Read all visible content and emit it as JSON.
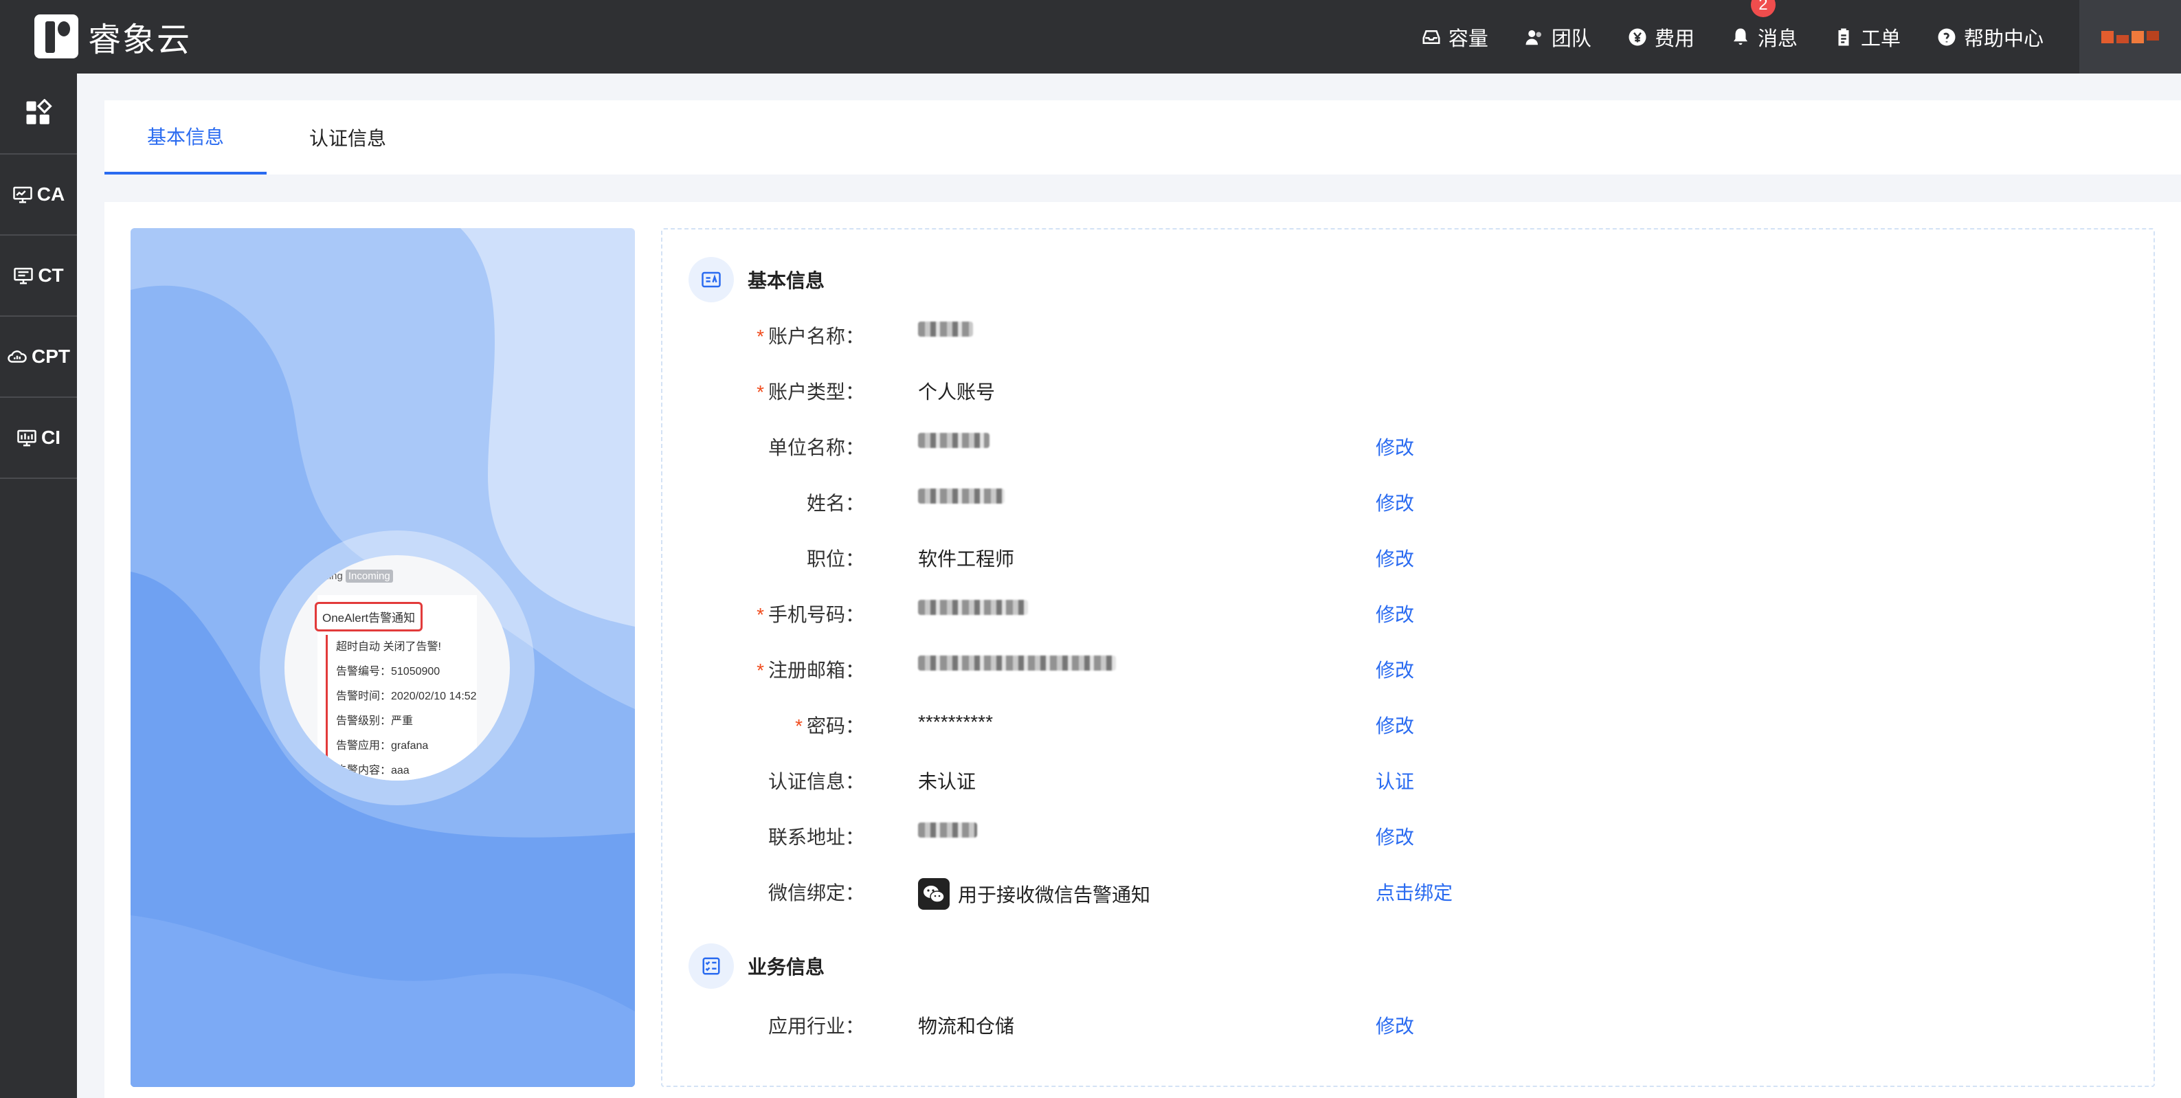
{
  "app": {
    "logo_text": "睿象云"
  },
  "topnav": {
    "items": [
      {
        "label": "容量",
        "icon": "inbox-icon"
      },
      {
        "label": "团队",
        "icon": "users-icon"
      },
      {
        "label": "费用",
        "icon": "yen-icon"
      },
      {
        "label": "消息",
        "icon": "bell-icon",
        "badge": "2"
      },
      {
        "label": "工单",
        "icon": "clipboard-icon"
      },
      {
        "label": "帮助中心",
        "icon": "help-icon"
      }
    ]
  },
  "sidebar": {
    "items": [
      {
        "label": "",
        "icon": "grid-icon"
      },
      {
        "label": "CA",
        "icon": "monitor-icon"
      },
      {
        "label": "CT",
        "icon": "monitor-icon"
      },
      {
        "label": "CPT",
        "icon": "cloud-icon"
      },
      {
        "label": "CI",
        "icon": "monitor-icon"
      }
    ]
  },
  "tabs": [
    {
      "label": "基本信息",
      "active": true
    },
    {
      "label": "认证信息",
      "active": false
    }
  ],
  "illustration": {
    "tag_prefix": "oming",
    "tag_badge": "Incoming",
    "alert_title": "OneAlert告警通知",
    "lines": [
      "超时自动 关闭了告警!",
      "告警编号：51050900",
      "告警时间：2020/02/10 14:52",
      "告警级别：严重",
      "告警应用：grafana",
      "告警内容：aaa"
    ]
  },
  "basic_section": {
    "title": "基本信息",
    "rows": [
      {
        "label": "账户名称：",
        "required": true,
        "value": "",
        "redacted": true,
        "action": ""
      },
      {
        "label": "账户类型：",
        "required": true,
        "value": "个人账号",
        "redacted": false,
        "action": ""
      },
      {
        "label": "单位名称：",
        "required": false,
        "value": "",
        "redacted": true,
        "action": "修改"
      },
      {
        "label": "姓名：",
        "required": false,
        "value": "",
        "redacted": true,
        "action": "修改"
      },
      {
        "label": "职位：",
        "required": false,
        "value": "软件工程师",
        "redacted": false,
        "action": "修改"
      },
      {
        "label": "手机号码：",
        "required": true,
        "value": "",
        "redacted": true,
        "action": "修改"
      },
      {
        "label": "注册邮箱：",
        "required": true,
        "value": "",
        "redacted": true,
        "action": "修改"
      },
      {
        "label": "密码：",
        "required": true,
        "value": "**********",
        "redacted": false,
        "action": "修改"
      },
      {
        "label": "认证信息：",
        "required": false,
        "value": "未认证",
        "redacted": false,
        "action": "认证"
      },
      {
        "label": "联系地址：",
        "required": false,
        "value": "",
        "redacted": true,
        "action": "修改"
      },
      {
        "label": "微信绑定：",
        "required": false,
        "value": "用于接收微信告警通知",
        "redacted": false,
        "action": "点击绑定"
      }
    ]
  },
  "business_section": {
    "title": "业务信息",
    "rows": [
      {
        "label": "应用行业：",
        "required": false,
        "value": "物流和仓储",
        "action": "修改"
      }
    ]
  },
  "colors": {
    "primary": "#2a6bf0",
    "required": "#f04d1f",
    "topbar": "#2f3033",
    "badge": "#f04d4d"
  }
}
